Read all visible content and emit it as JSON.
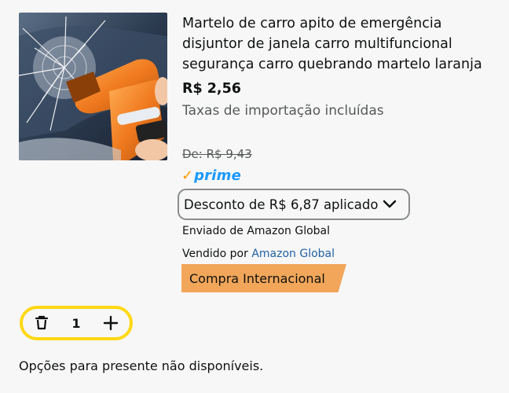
{
  "product": {
    "image_alt": "product-image-car-emergency-hammer",
    "title_lines": [
      "Martelo de carro apito de emergência",
      "disjuntor de janela carro multifuncional",
      "segurança carro quebrando martelo laranja"
    ],
    "price": "R$ 2,56",
    "tax_note": "Taxas de importação incluídas",
    "old_price": "De: R$ 9,43",
    "prime_check": "✓",
    "prime_label": "prime",
    "discount_label": "Desconto de R$ 6,87 aplicado",
    "shipped_by": "Enviado de Amazon Global",
    "sold_by_prefix": "Vendido por ",
    "sold_by_seller": "Amazon Global",
    "international_badge": "Compra Internacional"
  },
  "quantity": {
    "value": "1",
    "delete_icon": "trash-icon",
    "add_icon": "plus-icon"
  },
  "gift_options": "Opções para presente não disponíveis.",
  "colors": {
    "prime_blue": "#1a98ff",
    "prime_check": "#ff9900",
    "badge_orange": "#f2a65a",
    "qty_border": "#ffd814",
    "link_blue": "#2162a1"
  }
}
